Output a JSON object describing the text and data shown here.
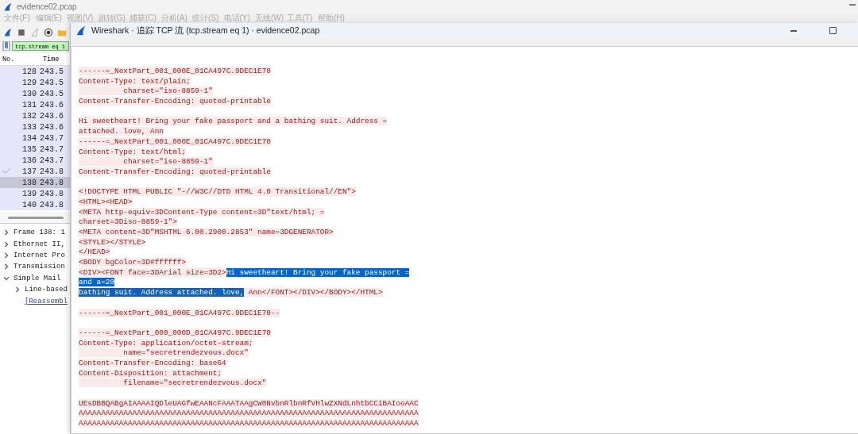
{
  "main_window": {
    "title": "evidence02.pcap",
    "menu": [
      "文件(F)",
      "编辑(E)",
      "视图(V)",
      "跳转(G)",
      "捕获(C)",
      "分析(A)",
      "统计(S)",
      "电话(Y)",
      "无线(W)",
      "工具(T)",
      "帮助(H)"
    ],
    "filter": {
      "value": "tcp.stream eq 1"
    },
    "packet_list": {
      "columns": [
        "No.",
        "Time"
      ],
      "rows": [
        {
          "no": "128",
          "time": "243.5",
          "selected": false,
          "related": false
        },
        {
          "no": "129",
          "time": "243.5",
          "selected": false,
          "related": false
        },
        {
          "no": "130",
          "time": "243.5",
          "selected": false,
          "related": false
        },
        {
          "no": "131",
          "time": "243.6",
          "selected": false,
          "related": false
        },
        {
          "no": "132",
          "time": "243.6",
          "selected": false,
          "related": false
        },
        {
          "no": "133",
          "time": "243.6",
          "selected": false,
          "related": false
        },
        {
          "no": "134",
          "time": "243.7",
          "selected": false,
          "related": false
        },
        {
          "no": "135",
          "time": "243.7",
          "selected": false,
          "related": false
        },
        {
          "no": "136",
          "time": "243.7",
          "selected": false,
          "related": false
        },
        {
          "no": "137",
          "time": "243.8",
          "selected": false,
          "related": true
        },
        {
          "no": "138",
          "time": "243.8",
          "selected": true,
          "related": false
        },
        {
          "no": "139",
          "time": "243.8",
          "selected": false,
          "related": false
        },
        {
          "no": "140",
          "time": "243.8",
          "selected": false,
          "related": false
        }
      ]
    },
    "details": [
      {
        "kind": "node",
        "label": "Frame 138: 1",
        "expanded": false
      },
      {
        "kind": "node",
        "label": "Ethernet II,",
        "expanded": false
      },
      {
        "kind": "node",
        "label": "Internet Pro",
        "expanded": false
      },
      {
        "kind": "node",
        "label": "Transmission",
        "expanded": false
      },
      {
        "kind": "node",
        "label": "Simple Mail",
        "expanded": true,
        "children": [
          {
            "kind": "node",
            "label": "Line-based",
            "expanded": false
          },
          {
            "kind": "link",
            "label": "[Reassembl"
          }
        ]
      }
    ]
  },
  "dialog": {
    "title": "Wireshark · 追踪 TCP 流 (tcp.stream eq 1) · evidence02.pcap",
    "blocks": [
      {
        "lines": [
          {
            "text": "------=_NextPart_001_000E_01CA497C.9DEC1E70"
          },
          {
            "text": "Content-Type: text/plain;"
          },
          {
            "text": "          charset=\"iso-8859-1\""
          },
          {
            "text": "Content-Transfer-Encoding: quoted-printable"
          }
        ]
      },
      {
        "lines": [
          {
            "text": "Hi sweetheart! Bring your fake passport and a bathing suit. Address ="
          },
          {
            "text": "attached. love, Ann"
          },
          {
            "text": "------=_NextPart_001_000E_01CA497C.9DEC1E70"
          },
          {
            "text": "Content-Type: text/html;"
          },
          {
            "text": "          charset=\"iso-8859-1\""
          },
          {
            "text": "Content-Transfer-Encoding: quoted-printable"
          }
        ]
      },
      {
        "lines": [
          {
            "text": "<!DOCTYPE HTML PUBLIC \"-//W3C//DTD HTML 4.0 Transitional//EN\">"
          },
          {
            "text": "<HTML><HEAD>"
          },
          {
            "text": "<META http-equiv=3DContent-Type content=3D\"text/html; ="
          },
          {
            "text": "charset=3Diso-8859-1\">"
          },
          {
            "text": "<META content=3D\"MSHTML 6.00.2900.2853\" name=3DGENERATOR>"
          },
          {
            "text": "<STYLE></STYLE>"
          },
          {
            "text": "</HEAD>"
          },
          {
            "text": "<BODY bgColor=3D#ffffff>"
          },
          {
            "segments": [
              {
                "text": "<DIV><FONT face=3DArial size=3D2>",
                "selected": false
              },
              {
                "text": "Hi sweetheart! Bring your fake passport =",
                "selected": true
              }
            ]
          },
          {
            "segments": [
              {
                "text": "and a=20",
                "selected": true
              }
            ]
          },
          {
            "segments": [
              {
                "text": "bathing suit. Address attached. love,",
                "selected": true
              },
              {
                "text": " Ann</FONT></DIV></BODY></HTML>",
                "selected": false
              }
            ]
          }
        ]
      },
      {
        "lines": [
          {
            "text": "------=_NextPart_001_000E_01CA497C.9DEC1E70--"
          }
        ]
      },
      {
        "lines": [
          {
            "text": "------=_NextPart_000_000D_01CA497C.9DEC1E70"
          },
          {
            "text": "Content-Type: application/octet-stream;"
          },
          {
            "text": "          name=\"secretrendezvous.docx\""
          },
          {
            "text": "Content-Transfer-Encoding: base64"
          },
          {
            "text": "Content-Disposition: attachment;"
          },
          {
            "text": "          filename=\"secretrendezvous.docx\""
          }
        ]
      },
      {
        "lines": [
          {
            "text": "UEsDBBQABgAIAAAAIQDleUAGfwEAANcFAAATAAgCW0NvbnRlbnRfVHlwZXNdLnhtbCCiBAIooAAC"
          },
          {
            "text": "AAAAAAAAAAAAAAAAAAAAAAAAAAAAAAAAAAAAAAAAAAAAAAAAAAAAAAAAAAAAAAAAAAAAAAAAAAAA"
          },
          {
            "text": "AAAAAAAAAAAAAAAAAAAAAAAAAAAAAAAAAAAAAAAAAAAAAAAAAAAAAAAAAAAAAAAAAAAAAAAAAAAA"
          }
        ]
      }
    ]
  }
}
